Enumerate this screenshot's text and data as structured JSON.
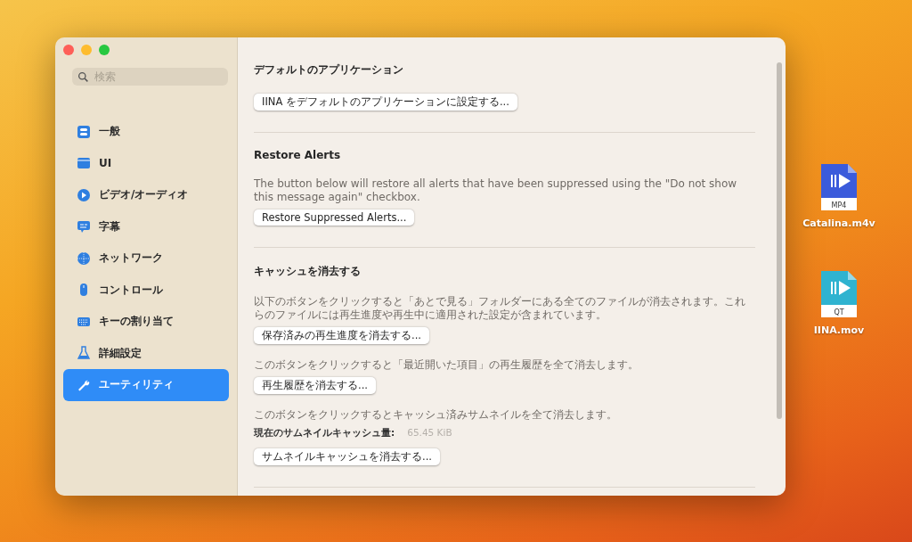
{
  "sidebar": {
    "search": {
      "placeholder": "検索"
    },
    "items": [
      {
        "label": "一般",
        "selected": false
      },
      {
        "label": "UI",
        "selected": false
      },
      {
        "label": "ビデオ/オーディオ",
        "selected": false
      },
      {
        "label": "字幕",
        "selected": false
      },
      {
        "label": "ネットワーク",
        "selected": false
      },
      {
        "label": "コントロール",
        "selected": false
      },
      {
        "label": "キーの割り当て",
        "selected": false
      },
      {
        "label": "詳細設定",
        "selected": false
      },
      {
        "label": "ユーティリティ",
        "selected": true
      }
    ]
  },
  "sections": [
    {
      "title": "デフォルトのアプリケーション",
      "blocks": [
        {
          "kind": "button",
          "label": "IINA をデフォルトのアプリケーションに設定する..."
        }
      ]
    },
    {
      "title": "Restore Alerts",
      "blocks": [
        {
          "kind": "text",
          "text": "The button below will restore all alerts that have been suppressed using the \"Do not show this message again\" checkbox."
        },
        {
          "kind": "button",
          "label": "Restore Suppressed Alerts..."
        }
      ]
    },
    {
      "title": "キャッシュを消去する",
      "blocks": [
        {
          "kind": "text",
          "text": "以下のボタンをクリックすると「あとで見る」フォルダーにある全てのファイルが消去されます。これらのファイルには再生進度や再生中に適用された設定が含まれています。"
        },
        {
          "kind": "button",
          "label": "保存済みの再生進度を消去する..."
        },
        {
          "kind": "text",
          "text": "このボタンをクリックすると「最近開いた項目」の再生履歴を全て消去します。"
        },
        {
          "kind": "button",
          "label": "再生履歴を消去する..."
        },
        {
          "kind": "text",
          "text": "このボタンをクリックするとキャッシュ済みサムネイルを全て消去します。"
        },
        {
          "kind": "stat",
          "label": "現在のサムネイルキャッシュ量:",
          "value": "65.45 KiB"
        },
        {
          "kind": "button",
          "label": "サムネイルキャッシュを消去する..."
        }
      ]
    }
  ],
  "desktop_files": [
    {
      "name": "Catalina.m4v",
      "type_label": "MP4",
      "color": "#3b5bdb"
    },
    {
      "name": "IINA.mov",
      "type_label": "QT",
      "color": "#2fb3d0"
    }
  ]
}
